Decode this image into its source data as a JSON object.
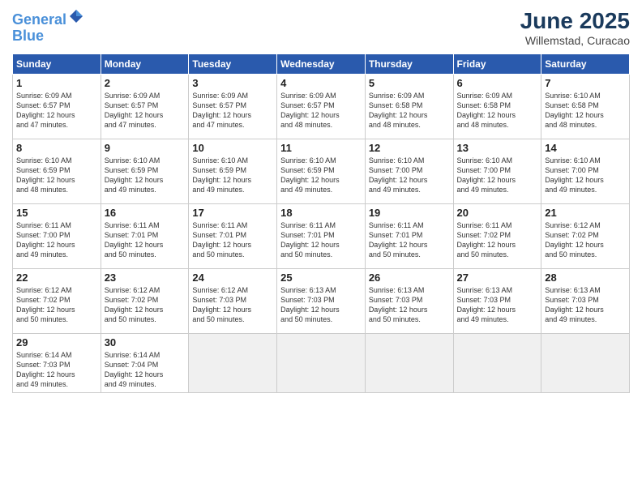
{
  "header": {
    "logo_line1": "General",
    "logo_line2": "Blue",
    "month": "June 2025",
    "location": "Willemstad, Curacao"
  },
  "days_of_week": [
    "Sunday",
    "Monday",
    "Tuesday",
    "Wednesday",
    "Thursday",
    "Friday",
    "Saturday"
  ],
  "weeks": [
    [
      {
        "day": "1",
        "info": "Sunrise: 6:09 AM\nSunset: 6:57 PM\nDaylight: 12 hours\nand 47 minutes."
      },
      {
        "day": "2",
        "info": "Sunrise: 6:09 AM\nSunset: 6:57 PM\nDaylight: 12 hours\nand 47 minutes."
      },
      {
        "day": "3",
        "info": "Sunrise: 6:09 AM\nSunset: 6:57 PM\nDaylight: 12 hours\nand 47 minutes."
      },
      {
        "day": "4",
        "info": "Sunrise: 6:09 AM\nSunset: 6:57 PM\nDaylight: 12 hours\nand 48 minutes."
      },
      {
        "day": "5",
        "info": "Sunrise: 6:09 AM\nSunset: 6:58 PM\nDaylight: 12 hours\nand 48 minutes."
      },
      {
        "day": "6",
        "info": "Sunrise: 6:09 AM\nSunset: 6:58 PM\nDaylight: 12 hours\nand 48 minutes."
      },
      {
        "day": "7",
        "info": "Sunrise: 6:10 AM\nSunset: 6:58 PM\nDaylight: 12 hours\nand 48 minutes."
      }
    ],
    [
      {
        "day": "8",
        "info": "Sunrise: 6:10 AM\nSunset: 6:59 PM\nDaylight: 12 hours\nand 48 minutes."
      },
      {
        "day": "9",
        "info": "Sunrise: 6:10 AM\nSunset: 6:59 PM\nDaylight: 12 hours\nand 49 minutes."
      },
      {
        "day": "10",
        "info": "Sunrise: 6:10 AM\nSunset: 6:59 PM\nDaylight: 12 hours\nand 49 minutes."
      },
      {
        "day": "11",
        "info": "Sunrise: 6:10 AM\nSunset: 6:59 PM\nDaylight: 12 hours\nand 49 minutes."
      },
      {
        "day": "12",
        "info": "Sunrise: 6:10 AM\nSunset: 7:00 PM\nDaylight: 12 hours\nand 49 minutes."
      },
      {
        "day": "13",
        "info": "Sunrise: 6:10 AM\nSunset: 7:00 PM\nDaylight: 12 hours\nand 49 minutes."
      },
      {
        "day": "14",
        "info": "Sunrise: 6:10 AM\nSunset: 7:00 PM\nDaylight: 12 hours\nand 49 minutes."
      }
    ],
    [
      {
        "day": "15",
        "info": "Sunrise: 6:11 AM\nSunset: 7:00 PM\nDaylight: 12 hours\nand 49 minutes."
      },
      {
        "day": "16",
        "info": "Sunrise: 6:11 AM\nSunset: 7:01 PM\nDaylight: 12 hours\nand 50 minutes."
      },
      {
        "day": "17",
        "info": "Sunrise: 6:11 AM\nSunset: 7:01 PM\nDaylight: 12 hours\nand 50 minutes."
      },
      {
        "day": "18",
        "info": "Sunrise: 6:11 AM\nSunset: 7:01 PM\nDaylight: 12 hours\nand 50 minutes."
      },
      {
        "day": "19",
        "info": "Sunrise: 6:11 AM\nSunset: 7:01 PM\nDaylight: 12 hours\nand 50 minutes."
      },
      {
        "day": "20",
        "info": "Sunrise: 6:11 AM\nSunset: 7:02 PM\nDaylight: 12 hours\nand 50 minutes."
      },
      {
        "day": "21",
        "info": "Sunrise: 6:12 AM\nSunset: 7:02 PM\nDaylight: 12 hours\nand 50 minutes."
      }
    ],
    [
      {
        "day": "22",
        "info": "Sunrise: 6:12 AM\nSunset: 7:02 PM\nDaylight: 12 hours\nand 50 minutes."
      },
      {
        "day": "23",
        "info": "Sunrise: 6:12 AM\nSunset: 7:02 PM\nDaylight: 12 hours\nand 50 minutes."
      },
      {
        "day": "24",
        "info": "Sunrise: 6:12 AM\nSunset: 7:03 PM\nDaylight: 12 hours\nand 50 minutes."
      },
      {
        "day": "25",
        "info": "Sunrise: 6:13 AM\nSunset: 7:03 PM\nDaylight: 12 hours\nand 50 minutes."
      },
      {
        "day": "26",
        "info": "Sunrise: 6:13 AM\nSunset: 7:03 PM\nDaylight: 12 hours\nand 50 minutes."
      },
      {
        "day": "27",
        "info": "Sunrise: 6:13 AM\nSunset: 7:03 PM\nDaylight: 12 hours\nand 49 minutes."
      },
      {
        "day": "28",
        "info": "Sunrise: 6:13 AM\nSunset: 7:03 PM\nDaylight: 12 hours\nand 49 minutes."
      }
    ],
    [
      {
        "day": "29",
        "info": "Sunrise: 6:14 AM\nSunset: 7:03 PM\nDaylight: 12 hours\nand 49 minutes."
      },
      {
        "day": "30",
        "info": "Sunrise: 6:14 AM\nSunset: 7:04 PM\nDaylight: 12 hours\nand 49 minutes."
      },
      {
        "day": "",
        "info": ""
      },
      {
        "day": "",
        "info": ""
      },
      {
        "day": "",
        "info": ""
      },
      {
        "day": "",
        "info": ""
      },
      {
        "day": "",
        "info": ""
      }
    ]
  ]
}
